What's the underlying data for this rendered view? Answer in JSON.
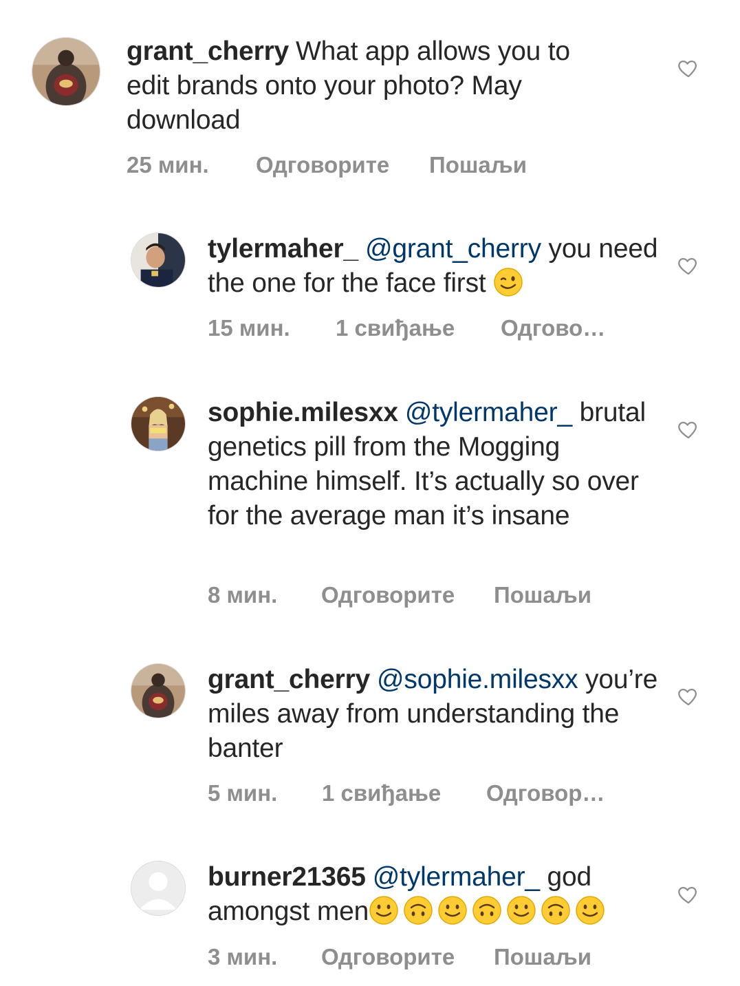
{
  "comments": [
    {
      "username": "grant_cherry",
      "mention": "",
      "text": "What app allows you to edit brands onto your photo? May download",
      "time": "25 мин.",
      "likes": "",
      "reply": "Одговорите",
      "send": "Пошаљи",
      "avatar": "grant-cherry-avatar"
    },
    {
      "username": "tylermaher_",
      "mention": "@grant_cherry",
      "text": "you need the one for the face first",
      "emoji": [
        "wink"
      ],
      "time": "15 мин.",
      "likes": "1 свиђање",
      "reply": "Одгово…",
      "send": "",
      "avatar": "tylermaher-avatar"
    },
    {
      "username": "sophie.milesxx",
      "mention": "@tylermaher_",
      "text": "brutal genetics pill from the Mogging machine himself. It’s actually so over for the average man it’s insane",
      "time": "8 мин.",
      "likes": "",
      "reply": "Одговорите",
      "send": "Пошаљи",
      "avatar": "sophie-avatar"
    },
    {
      "username": "grant_cherry",
      "mention": "@sophie.milesxx",
      "text": "you’re miles away from understanding the banter",
      "time": "5 мин.",
      "likes": "1 свиђање",
      "reply": "Одговор…",
      "send": "",
      "avatar": "grant-cherry-avatar"
    },
    {
      "username": "burner21365",
      "mention": "@tylermaher_",
      "text": "god amongst men",
      "emoji": [
        "smile",
        "upside-down",
        "smile",
        "upside-down",
        "smile",
        "upside-down",
        "smile"
      ],
      "time": "3 мин.",
      "likes": "",
      "reply": "Одговорите",
      "send": "Пошаљи",
      "avatar": "default-avatar"
    }
  ],
  "colors": {
    "text": "#262626",
    "mention": "#00376b",
    "meta": "#8e8e8e",
    "heart_outline": "#8e8e8e",
    "emoji_yellow": "#ffcc33"
  },
  "icons": {
    "like": "heart-outline-icon"
  }
}
